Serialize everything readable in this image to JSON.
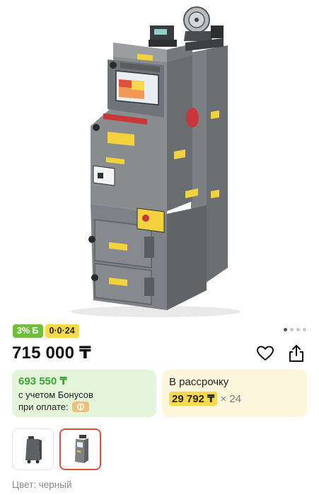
{
  "product": {
    "image_alt": "Grey solid fuel boiler",
    "cashback_badge": "3% Б",
    "installment_badge": "0·0·24",
    "price": "715 000 ₸",
    "gallery_dots": 4
  },
  "bonus_card": {
    "price": "693 550 ₸",
    "line1": "с учетом Бонусов",
    "line2": "при оплате:",
    "pay_icon": "payment-logo-icon"
  },
  "credit_card": {
    "title": "В рассрочку",
    "amount": "29 792 ₸",
    "term": "× 24"
  },
  "thumbnails": [
    {
      "name": "thumbnail-1",
      "selected": false
    },
    {
      "name": "thumbnail-2",
      "selected": true
    }
  ],
  "color": {
    "label": "Цвет: черный"
  },
  "colors": {
    "green": "#3fa335",
    "bonus_bg": "#e4f5da",
    "credit_bg": "#fdf5dc",
    "yellow": "#f7d94a",
    "selected_border": "#e0513c"
  },
  "icons": {
    "favorite": "heart-icon",
    "share": "share-icon"
  }
}
